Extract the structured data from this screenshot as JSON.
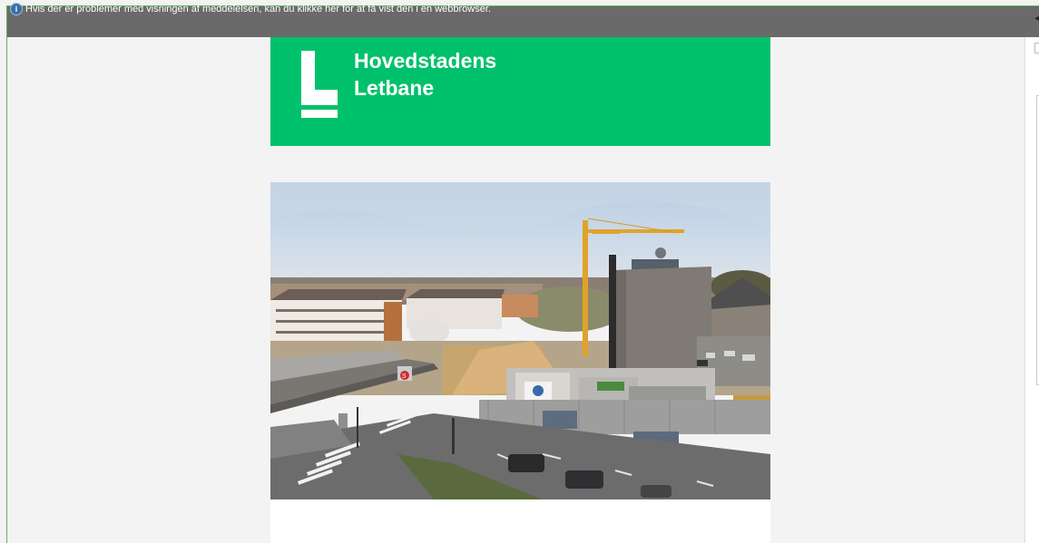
{
  "infobar": {
    "message": "Hvis der er problemer med visningen af meddelelsen, kan du klikke her for at få vist den i en webbrowser.",
    "icon": "info-icon"
  },
  "email": {
    "header_color": "#00c16b",
    "logo": {
      "line1": "Hovedstadens",
      "line2": "Letbane"
    },
    "photo": {
      "subject": "construction-site-photo"
    }
  }
}
